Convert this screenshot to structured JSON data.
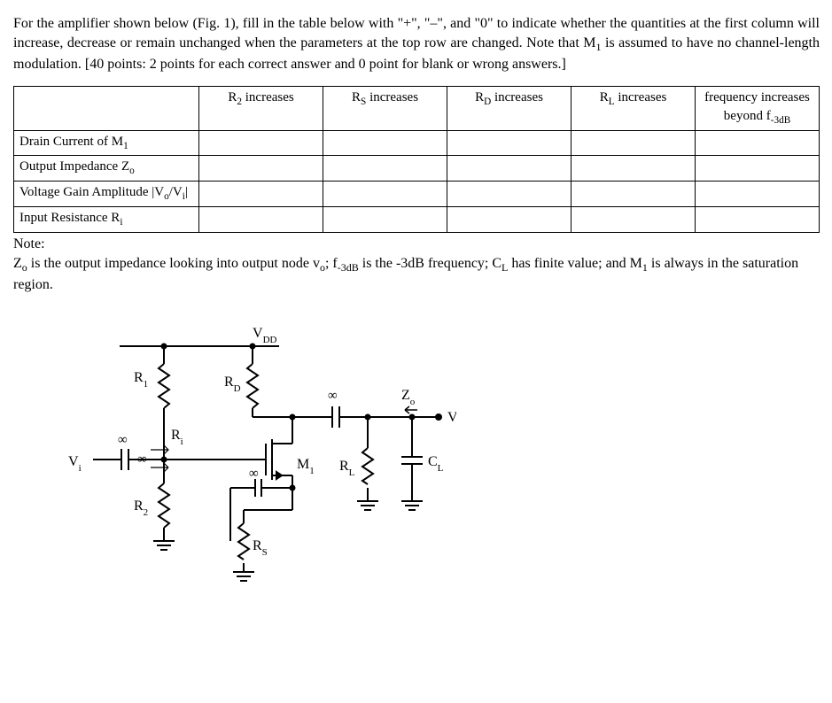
{
  "intro": "For the amplifier shown below (Fig. 1), fill in the table below with “+”, “–”, and “0” to indicate whether the quantities at the first column will increase, decrease or remain unchanged when the parameters at the top row are changed. Note that M₁ is assumed to have no channel-length modulation. [40 points: 2 points for each correct answer and 0 point for blank or wrong answers.]",
  "table": {
    "headers": {
      "h1": "R₂ increases",
      "h2": "Rₛ increases",
      "h3": "R_D increases",
      "h4": "R_L increases",
      "h5": "frequency increases beyond f₋₃dB"
    },
    "rows": {
      "r1": "Drain Current of M₁",
      "r2": "Output Impedance Zₒ",
      "r3": "Voltage Gain Amplitude |Vₒ/Vᵢ|",
      "r4": "Input Resistance Rᵢ"
    }
  },
  "note_title": "Note:",
  "note_text": "Zₒ is the output impedance looking into output node vₒ; f₋₃dB is the -3dB frequency; C_L has finite value; and M₁ is always in the saturation region.",
  "circuit": {
    "vdd": "V_DD",
    "r1": "R₁",
    "r2": "R₂",
    "rd": "R_D",
    "rs": "R_S",
    "rl": "R_L",
    "cl": "C_L",
    "m1": "M₁",
    "vi": "Vᵢ",
    "vo": "Vₒ",
    "zo": "Zₒ",
    "ri": "Rᵢ",
    "inf": "∞"
  }
}
